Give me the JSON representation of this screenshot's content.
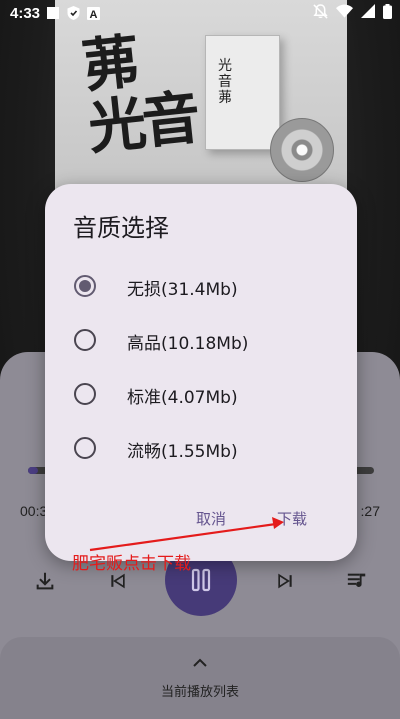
{
  "status_bar": {
    "time": "4:33",
    "notification_icons": [
      "notification-block-icon",
      "shield-icon",
      "a-letter-icon"
    ],
    "system_icons": [
      "mute-notifications-icon",
      "wifi-icon",
      "signal-icon",
      "battery-icon"
    ]
  },
  "album_art": {
    "title_glyphs": "茀\n光音",
    "box_text": "光\n音\n茀"
  },
  "dialog": {
    "title": "音质选择",
    "options": [
      {
        "label": "无损(31.4Mb)",
        "selected": true
      },
      {
        "label": "高品(10.18Mb)",
        "selected": false
      },
      {
        "label": "标准(4.07Mb)",
        "selected": false
      },
      {
        "label": "流畅(1.55Mb)",
        "selected": false
      }
    ],
    "cancel_label": "取消",
    "download_label": "下载"
  },
  "player": {
    "time_current": "00:3",
    "time_total": ":27",
    "progress": 0.03,
    "controls": [
      "download-icon",
      "skip-previous-icon",
      "pause-icon",
      "skip-next-icon",
      "playlist-icon"
    ]
  },
  "queue": {
    "label": "当前播放列表"
  },
  "annotation": {
    "text": "肥宅贩点击下载",
    "color": "#e41b1b"
  },
  "colors": {
    "accent": "#625b71",
    "dialog_bg": "#ece6ef",
    "button_text": "#65558f",
    "play_button": "#463a78"
  }
}
